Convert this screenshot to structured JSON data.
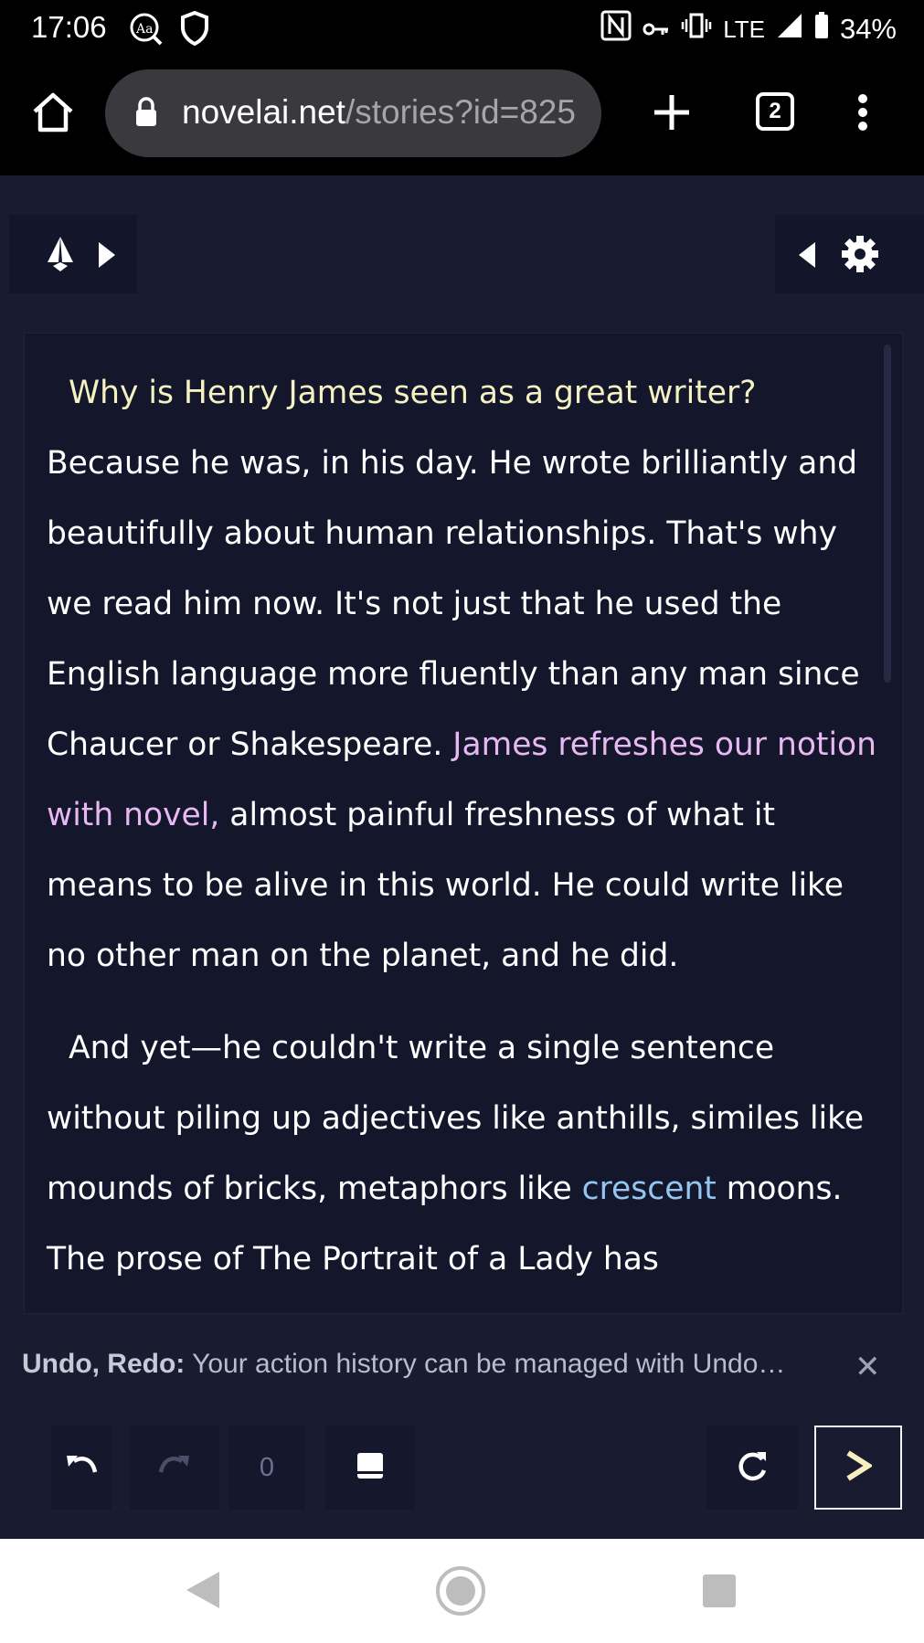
{
  "status_bar": {
    "time": "17:06",
    "network": "LTE",
    "battery": "34%"
  },
  "browser": {
    "url_host": "novelai.net",
    "url_path": "/stories?id=825",
    "tab_count": "2"
  },
  "editor": {
    "paragraph1_prompt": "Why is Henry James seen as a great writer?",
    "paragraph1_text_a": "Because he was, in his day. He wrote brilliantly and beautifully about human relationships. That's why we read him now. It's not just that he used the English language more fluently than any man since Chaucer or Shakespeare. ",
    "paragraph1_highlight": "James refreshes our notion with novel,",
    "paragraph1_text_b": " almost painful freshness of what it means to be alive in this world. He could write like no other man on the planet, and he did.",
    "paragraph2_text_a": "And yet—he couldn't write a single sentence without piling up adjectives like anthills, similes like mounds of bricks, metaphors like ",
    "paragraph2_highlight": "crescent",
    "paragraph2_text_b": " moons. The prose of The Portrait of a Lady has"
  },
  "tip": {
    "title": "Undo, Redo:",
    "text": "Your action history can be managed with Undo…",
    "close": "✕"
  },
  "actions": {
    "history_count": "0"
  },
  "colors": {
    "background": "#191b31",
    "prompt_text": "#f4f1c3",
    "edited_text": "#e8b8f2",
    "user_text": "#93c7ef"
  }
}
